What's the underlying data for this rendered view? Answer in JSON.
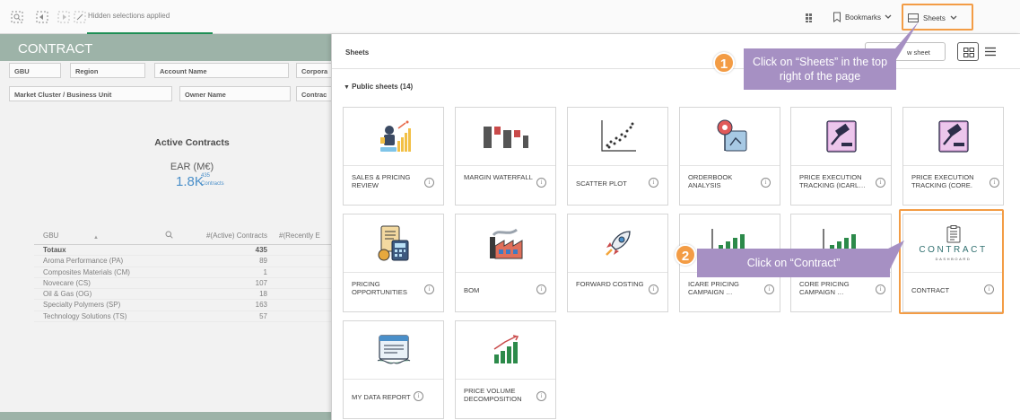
{
  "toolbar": {
    "hidden_selections": "Hidden selections applied",
    "bookmarks_label": "Bookmarks",
    "sheets_label": "Sheets"
  },
  "page": {
    "title": "CONTRACT",
    "filters_row1": [
      "GBU",
      "Region",
      "Account Name",
      "Corpora"
    ],
    "filters_row2": [
      "Market Cluster / Business Unit",
      "Owner Name",
      "Contrac"
    ],
    "kpi": {
      "title": "Active Contracts",
      "subtitle": "EAR (M€)",
      "value": "1.8K",
      "count": "435",
      "count_caption": "Contracts"
    },
    "table": {
      "headers": [
        "GBU",
        "#(Active) Contracts",
        "#(Recently E"
      ],
      "rows": [
        [
          "Totaux",
          "435"
        ],
        [
          "Aroma Performance (PA)",
          "89"
        ],
        [
          "Composites Materials (CM)",
          "1"
        ],
        [
          "Novecare (CS)",
          "107"
        ],
        [
          "Oil & Gas (OG)",
          "18"
        ],
        [
          "Specialty Polymers (SP)",
          "163"
        ],
        [
          "Technology Solutions (TS)",
          "57"
        ]
      ]
    }
  },
  "panel": {
    "title": "Sheets",
    "new_sheet_label": "w sheet",
    "section_label": "Public sheets (14)",
    "sheets": [
      {
        "label": "SALES & PRICING REVIEW",
        "icon": "sales-pricing-icon"
      },
      {
        "label": "MARGIN WATERFALL",
        "icon": "waterfall-chart-icon"
      },
      {
        "label": "SCATTER PLOT",
        "icon": "scatter-plot-icon"
      },
      {
        "label": "ORDERBOOK ANALYSIS",
        "icon": "orderbook-icon"
      },
      {
        "label": "PRICE EXECUTION TRACKING (ICARL…",
        "icon": "gavel-book-icon"
      },
      {
        "label": "PRICE EXECUTION TRACKING (CORE.",
        "icon": "gavel-book-icon"
      },
      {
        "label": "PRICING OPPORTUNITIES",
        "icon": "calculator-icon"
      },
      {
        "label": "BOM",
        "icon": "factory-icon"
      },
      {
        "label": "FORWARD COSTING",
        "icon": "rocket-icon"
      },
      {
        "label": "ICARE PRICING CAMPAIGN …",
        "icon": "bar-chart-icon"
      },
      {
        "label": "CORE PRICING CAMPAIGN …",
        "icon": "bar-chart-icon"
      },
      {
        "label": "CONTRACT",
        "icon": "contract-dashboard-icon"
      },
      {
        "label": "MY DATA REPORT",
        "icon": "report-icon"
      },
      {
        "label": "PRICE VOLUME DECOMPOSITION",
        "icon": "growth-chart-icon"
      }
    ],
    "contract_logo_text": "CONTRACT",
    "contract_logo_sub": "DASHBOARD"
  },
  "callouts": [
    {
      "num": "1",
      "text": "Click on “Sheets” in the top right of the page"
    },
    {
      "num": "2",
      "text": "Click on “Contract”"
    }
  ],
  "colors": {
    "accent_orange": "#f39c45",
    "callout_purple": "#a690c3",
    "header_green": "#9db3a8",
    "kpi_blue": "#4a8fc9"
  }
}
